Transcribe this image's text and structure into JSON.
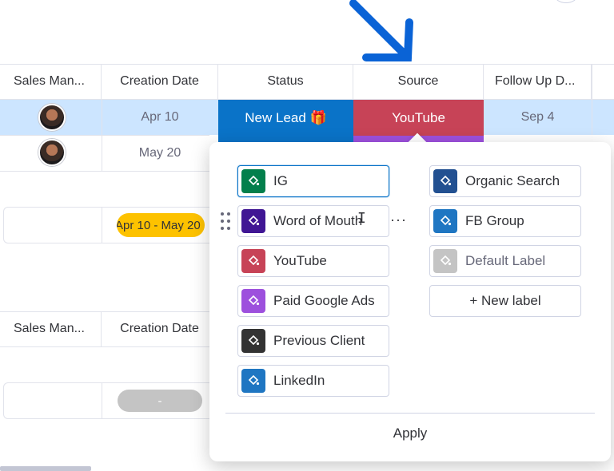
{
  "table_top": {
    "headers": [
      "Sales Man...",
      "Creation Date",
      "Status",
      "Source",
      "Follow Up D..."
    ],
    "rows": [
      {
        "creation_date": "Apr 10",
        "status": "New Lead 🎁",
        "source": "YouTube",
        "follow_up": "Sep 4"
      },
      {
        "creation_date": "May 20"
      }
    ],
    "summary_range": "Apr 10 - May 20"
  },
  "table_bottom": {
    "headers": [
      "Sales Man...",
      "Creation Date"
    ],
    "summary_range": "-"
  },
  "label_popup": {
    "left_labels": [
      {
        "name": "IG",
        "color": "#037f4c"
      },
      {
        "name": "Word of Mouth",
        "color": "#401694"
      },
      {
        "name": "YouTube",
        "color": "#c74357"
      },
      {
        "name": "Paid Google Ads",
        "color": "#9d50dd"
      },
      {
        "name": "Previous Client",
        "color": "#333333"
      },
      {
        "name": "LinkedIn",
        "color": "#1f76c2"
      }
    ],
    "right_labels": [
      {
        "name": "Organic Search",
        "color": "#225091"
      },
      {
        "name": "FB Group",
        "color": "#1f76c2"
      },
      {
        "name": "Default Label",
        "color": "#c4c4c4"
      }
    ],
    "new_label": "+ New label",
    "apply": "Apply",
    "more": "···"
  },
  "colors": {
    "selected_row": "#cce5ff",
    "status_new_lead": "#0a73c8",
    "source_youtube": "#c74357",
    "summary_pill": "#fdc200",
    "empty_pill": "#c4c4c4",
    "arrow": "#0a63d6"
  },
  "icons": {
    "label_swatch": "paint-bucket-icon",
    "arrow": "arrow-down-right-icon"
  }
}
